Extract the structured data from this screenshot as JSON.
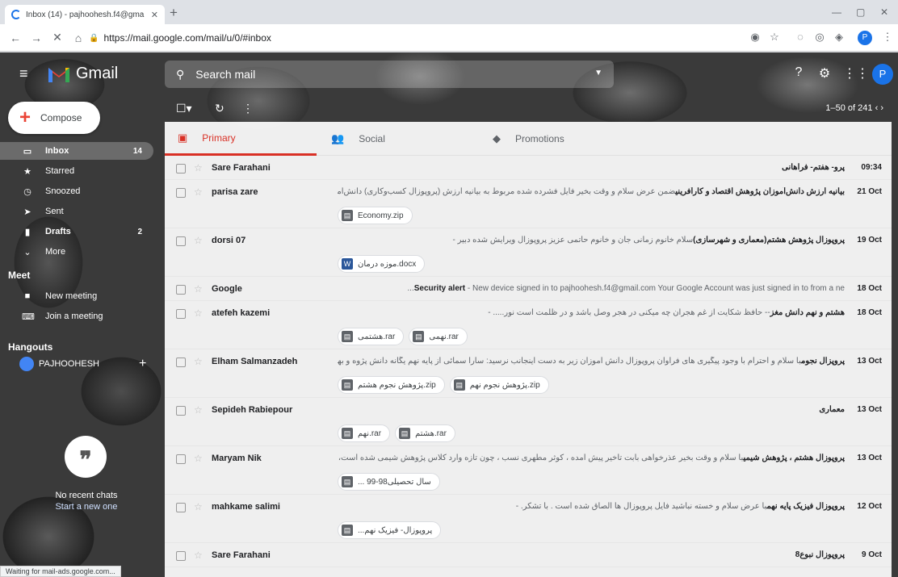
{
  "browser": {
    "tab_title": "Inbox (14) - pajhoohesh.f4@gma",
    "url": "https://mail.google.com/mail/u/0/#inbox",
    "profile_initial": "P"
  },
  "gmail": {
    "logo_text": "Gmail",
    "search_placeholder": "Search mail",
    "avatar_initial": "P",
    "pager": "1–50 of 241",
    "compose_label": "Compose"
  },
  "sidebar": {
    "items": [
      {
        "label": "Inbox",
        "count": "14",
        "icon": "inbox-icon",
        "glyph": "▭"
      },
      {
        "label": "Starred",
        "count": "",
        "icon": "star-icon",
        "glyph": "★"
      },
      {
        "label": "Snoozed",
        "count": "",
        "icon": "clock-icon",
        "glyph": "◷"
      },
      {
        "label": "Sent",
        "count": "",
        "icon": "send-icon",
        "glyph": "➤"
      },
      {
        "label": "Drafts",
        "count": "2",
        "icon": "draft-icon",
        "glyph": "▮"
      },
      {
        "label": "More",
        "count": "",
        "icon": "chevron-down-icon",
        "glyph": "⌄"
      }
    ],
    "meet_title": "Meet",
    "meet_items": [
      {
        "label": "New meeting",
        "icon": "video-icon",
        "glyph": "■"
      },
      {
        "label": "Join a meeting",
        "icon": "keyboard-icon",
        "glyph": "⌨"
      }
    ],
    "hangouts_title": "Hangouts",
    "hangouts_user": "PAJHOOHESH",
    "no_recent": "No recent chats",
    "start_new": "Start a new one"
  },
  "tabs": [
    {
      "label": "Primary",
      "icon": "inbox-icon",
      "glyph": "▣"
    },
    {
      "label": "Social",
      "icon": "people-icon",
      "glyph": "👥"
    },
    {
      "label": "Promotions",
      "icon": "tag-icon",
      "glyph": "◆"
    }
  ],
  "emails": [
    {
      "sender": "Sare Farahani",
      "subject": "",
      "subject_bold": "پرو- هفتم- فراهانی",
      "date": "09:34",
      "attachments": []
    },
    {
      "sender": "parisa zare",
      "subject": "ضمن عرض سلام و وقت بخیر فایل فشرده شده مربوط به بیانیه ارزش (پروپوزال کسب‌وکاری) دانش‌آموزان پـ ...- ",
      "subject_bold": "بیانیه ارزش دانش‌آموزان پژوهش اقتصاد و کارآفرینی",
      "date": "21 Oct",
      "attachments": [
        {
          "name": "Economy.zip",
          "type": "zip"
        }
      ]
    },
    {
      "sender": "dorsi 07",
      "subject": "سلام خانوم زمانی جان و خانوم حاتمی عزیز پروپوزال ویرایش شده دبیر - ",
      "subject_bold": "پروپوزال پژوهش هشتم(معماری و شهرسازی)",
      "date": "19 Oct",
      "attachments": [
        {
          "name": "موزه درمان.docx",
          "type": "word"
        }
      ]
    },
    {
      "sender": "Google",
      "subject": " - New device signed in to pajhoohesh.f4@gmail.com Your Google Account was just signed in to from a ne...",
      "subject_bold": "Security alert",
      "date": "18 Oct",
      "attachments": []
    },
    {
      "sender": "atefeh kazemi",
      "subject": "-- حافظ شکایت از غم هجران چه میکنی در هجر وصل باشد و در ظلمت است نور..... - ",
      "subject_bold": "هشتم و نهم دانش مغز",
      "date": "18 Oct",
      "attachments": [
        {
          "name": "هشتمی.rar",
          "type": "zip"
        },
        {
          "name": "نهمی.rar",
          "type": "zip"
        }
      ]
    },
    {
      "sender": "Elham Salmanzadeh",
      "subject": "با سلام و احترام با وجود پیگیری های فراوان پروپوزال دانش آموزان زیر به دست اینجانب نرسید: سارا سمائی از پایه نهم یگانه دانش پژوه و بهار عبداش... - ",
      "subject_bold": "پروپزال نجوم",
      "date": "13 Oct",
      "attachments": [
        {
          "name": "پژوهش نجوم هشتم.zip",
          "type": "zip"
        },
        {
          "name": "پژوهش نجوم نهم.zip",
          "type": "zip"
        }
      ]
    },
    {
      "sender": "Sepideh Rabiepour",
      "subject": "",
      "subject_bold": "معماری",
      "date": "13 Oct",
      "attachments": [
        {
          "name": "نهم.rar",
          "type": "zip"
        },
        {
          "name": "هشتم.rar",
          "type": "zip"
        }
      ]
    },
    {
      "sender": "Maryam Nik",
      "subject": "با سلام و وقت بخیر عذرخواهی بابت تاخیر پیش آمده ، کوثر مطهری نسب ، چون تازه وارد کلاس پژوهش شیمی شده است، هنوز مو... - ",
      "subject_bold": "پروپوزال هشتم ، پژوهش شیمی",
      "date": "13 Oct",
      "attachments": [
        {
          "name": "... سال تحصیلی98-99",
          "type": "zip"
        }
      ]
    },
    {
      "sender": "mahkame salimi",
      "subject": "با عرض سلام و خسته نباشید فایل پروپوزال ها الصاق شده است . با تشکر. - ",
      "subject_bold": "پروپوزال فیزیک پایه نهم",
      "date": "12 Oct",
      "attachments": [
        {
          "name": "...پروپوزال- فیزیک نهم",
          "type": "zip"
        }
      ]
    },
    {
      "sender": "Sare Farahani",
      "subject": "",
      "subject_bold": "پروپوزال نبوع8",
      "date": "9 Oct",
      "attachments": []
    }
  ],
  "status": "Waiting for mail-ads.google.com..."
}
